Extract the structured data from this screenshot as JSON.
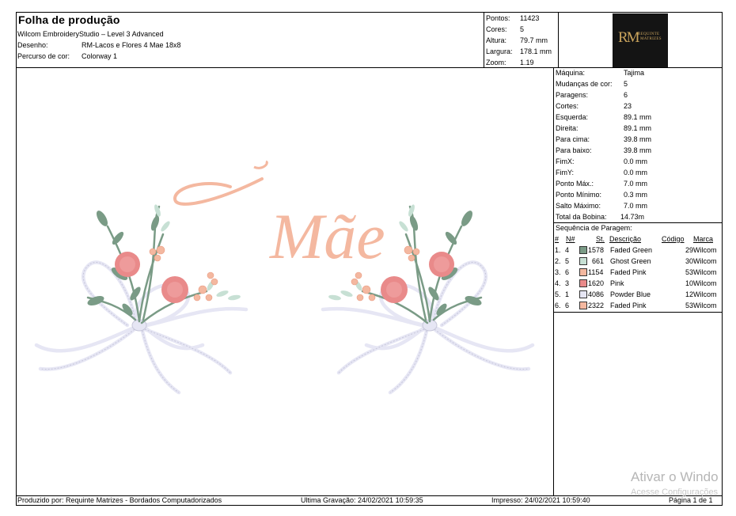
{
  "header": {
    "title": "Folha de produção",
    "software": "Wilcom EmbroideryStudio – Level 3 Advanced",
    "design_label": "Desenho:",
    "design_value": "RM-Lacos e Flores 4 Mae 18x8",
    "colorway_label": "Percurso de cor:",
    "colorway_value": "Colorway 1"
  },
  "stats": [
    {
      "label": "Pontos:",
      "value": "11423"
    },
    {
      "label": "Cores:",
      "value": "5"
    },
    {
      "label": "Altura:",
      "value": "79.7 mm"
    },
    {
      "label": "Largura:",
      "value": "178.1 mm"
    },
    {
      "label": "Zoom:",
      "value": "1.19"
    }
  ],
  "logo": {
    "monogram": "RM",
    "line1": "REQUINTE",
    "line2": "MATRIZES"
  },
  "design_text": "Mãe",
  "machine": [
    {
      "label": "Máquina:",
      "value": "Tajima"
    },
    {
      "label": "Mudanças de cor:",
      "value": "5"
    },
    {
      "label": "Paragens:",
      "value": "6"
    },
    {
      "label": "Cortes:",
      "value": "23"
    },
    {
      "label": "Esquerda:",
      "value": "89.1 mm"
    },
    {
      "label": "Direita:",
      "value": "89.1 mm"
    },
    {
      "label": "Para cima:",
      "value": "39.8 mm"
    },
    {
      "label": "Para baixo:",
      "value": "39.8 mm"
    },
    {
      "label": "FimX:",
      "value": "0.0 mm"
    },
    {
      "label": "FimY:",
      "value": "0.0 mm"
    },
    {
      "label": "Ponto Máx.:",
      "value": "7.0 mm"
    },
    {
      "label": "Ponto Mínimo:",
      "value": "0.3 mm"
    },
    {
      "label": "Salto Máximo:",
      "value": "7.0 mm"
    },
    {
      "label": "Total da Bobina:",
      "value": "14.73m"
    }
  ],
  "sequence": {
    "title": "Sequência de Paragem:",
    "columns": {
      "num": "#",
      "n": "N#",
      "st": "St.",
      "desc": "Descrição",
      "code": "Código",
      "brand": "Marca"
    },
    "rows": [
      {
        "num": "1.",
        "n": "4",
        "st": "1578",
        "desc": "Faded Green",
        "code": "29",
        "brand": "Wilcom",
        "color": "#7a9b86"
      },
      {
        "num": "2.",
        "n": "5",
        "st": "661",
        "desc": "Ghost Green",
        "code": "30",
        "brand": "Wilcom",
        "color": "#c7e0d4"
      },
      {
        "num": "3.",
        "n": "6",
        "st": "1154",
        "desc": "Faded Pink",
        "code": "53",
        "brand": "Wilcom",
        "color": "#f4b8a0"
      },
      {
        "num": "4.",
        "n": "3",
        "st": "1620",
        "desc": "Pink",
        "code": "10",
        "brand": "Wilcom",
        "color": "#e98a8a"
      },
      {
        "num": "5.",
        "n": "1",
        "st": "4086",
        "desc": "Powder Blue",
        "code": "12",
        "brand": "Wilcom",
        "color": "#e6e6f4"
      },
      {
        "num": "6.",
        "n": "6",
        "st": "2322",
        "desc": "Faded Pink",
        "code": "53",
        "brand": "Wilcom",
        "color": "#f4b8a0"
      }
    ]
  },
  "footer": {
    "produced": "Produzido por: Requinte Matrizes - Bordados Computadorizados",
    "saved": "Ultima Gravação: 24/02/2021 10:59:35",
    "printed": "Impresso: 24/02/2021 10:59:40",
    "page": "Página 1 de 1"
  },
  "watermark": {
    "line1": "Ativar o Windo",
    "line2": "Acesse Configurações"
  }
}
